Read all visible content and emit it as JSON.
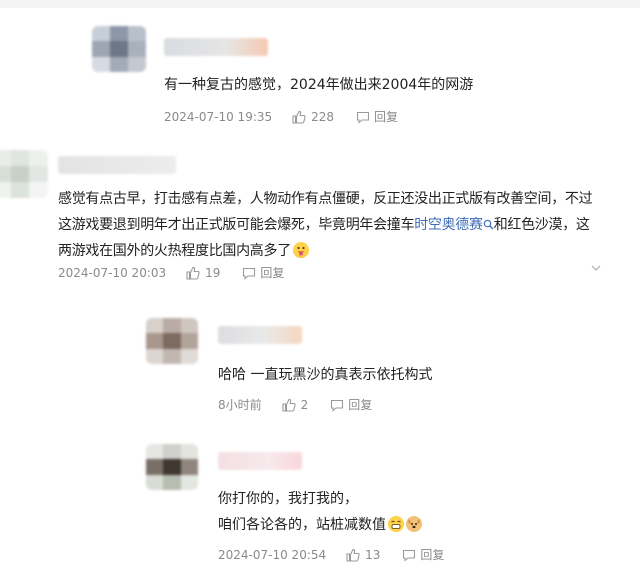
{
  "comments": [
    {
      "text_lines": [
        "有一种复古的感觉，2024年做出来2004年的网游"
      ],
      "time": "2024-07-10 19:35",
      "likes": "228",
      "reply_label": "回复"
    },
    {
      "text_lines": [
        "感觉有点古早，打击感有点差，人物动作有点僵硬，反正还没出正式版有改善空间，不过",
        "这游戏要退到明年才出正式版可能会爆死，毕竟明年会撞车",
        "时空奥德赛",
        "和红色沙漠，这",
        "两游戏在国外的火热程度比国内高多了"
      ],
      "time": "2024-07-10 20:03",
      "likes": "19",
      "reply_label": "回复"
    },
    {
      "text_lines": [
        "哈哈 一直玩黑沙的真表示依托构式"
      ],
      "time": "8小时前",
      "likes": "2",
      "reply_label": "回复"
    },
    {
      "text_lines": [
        "你打你的，我打我的，",
        "咱们各论各的，站桩减数值"
      ],
      "time": "2024-07-10 20:54",
      "likes": "13",
      "reply_label": "回复"
    }
  ],
  "icons": {
    "like": "thumbs-up-icon",
    "reply": "comment-bubble-icon",
    "more": "chevron-down-icon",
    "search_link": "search-icon",
    "emoji_cheeky": "tongue-face-emoji",
    "emoji_grin": "grinning-face-emoji",
    "emoji_dog": "dog-face-emoji"
  },
  "colors": {
    "link": "#3d6bb5",
    "meta": "#8a8a8a",
    "text": "#222222"
  }
}
